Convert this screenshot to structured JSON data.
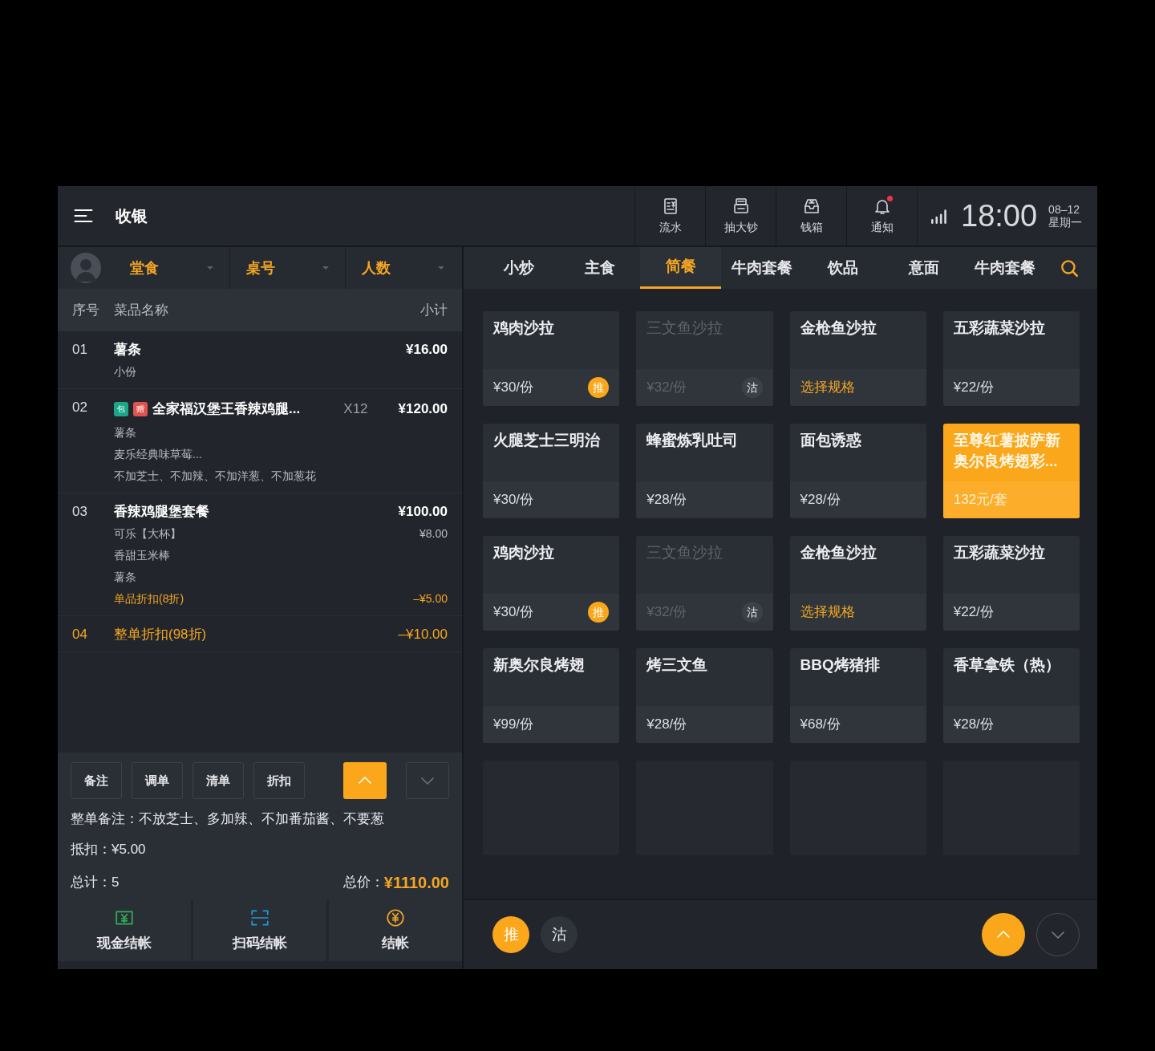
{
  "header": {
    "title": "收银"
  },
  "tools": [
    {
      "label": "流水",
      "kind": "ledger",
      "alert": false
    },
    {
      "label": "抽大钞",
      "kind": "printer",
      "alert": false
    },
    {
      "label": "钱箱",
      "kind": "drawer",
      "alert": false
    },
    {
      "label": "通知",
      "kind": "bell",
      "alert": true
    }
  ],
  "status": {
    "time": "18:00",
    "date": "08–12",
    "weekday": "星期一"
  },
  "filters": [
    {
      "label": "堂食"
    },
    {
      "label": "桌号"
    },
    {
      "label": "人数"
    }
  ],
  "tabs": [
    {
      "label": "小炒",
      "selected": false
    },
    {
      "label": "主食",
      "selected": false
    },
    {
      "label": "简餐",
      "selected": true
    },
    {
      "label": "牛肉套餐",
      "selected": false
    },
    {
      "label": "饮品",
      "selected": false
    },
    {
      "label": "意面",
      "selected": false
    },
    {
      "label": "牛肉套餐",
      "selected": false
    }
  ],
  "order": {
    "columns": [
      "序号",
      "菜品名称",
      "小计"
    ],
    "rows": [
      {
        "kind": "item",
        "index": "01",
        "name": "薯条",
        "price": "¥16.00",
        "details": [
          {
            "kind": "option",
            "text": "小份"
          }
        ]
      },
      {
        "kind": "item",
        "index": "02",
        "tags": [
          {
            "label": "包",
            "color": "#1aa88a"
          },
          {
            "label": "赠",
            "color": "#e0524f"
          }
        ],
        "name": "全家福汉堡王香辣鸡腿...",
        "qty": "X12",
        "price": "¥120.00",
        "details": [
          {
            "kind": "option",
            "text": "薯条"
          },
          {
            "kind": "option",
            "text": "麦乐经典味草莓..."
          },
          {
            "kind": "option",
            "text": "不加芝士、不加辣、不加洋葱、不加葱花"
          }
        ]
      },
      {
        "kind": "item",
        "index": "03",
        "name": "香辣鸡腿堡套餐",
        "price": "¥100.00",
        "details": [
          {
            "kind": "option",
            "text": "可乐【大杯】",
            "price": "¥8.00"
          },
          {
            "kind": "option",
            "text": "香甜玉米棒"
          },
          {
            "kind": "option",
            "text": "薯条"
          },
          {
            "kind": "discount",
            "text": "单品折扣(8折)",
            "price": "–¥5.00"
          }
        ]
      },
      {
        "kind": "discount",
        "index": "04",
        "name": "整单折扣(98折)",
        "price": "–¥10.00"
      }
    ]
  },
  "actions": [
    "备注",
    "调单",
    "清单",
    "折扣"
  ],
  "order_scroll": [
    {
      "kind": "up",
      "selected": true
    },
    {
      "kind": "down",
      "selected": false
    }
  ],
  "note": "整单备注：不放芝士、多加辣、不加番茄酱、不要葱",
  "deduction": "抵扣：¥5.00",
  "count": "总计：5",
  "total_label": "总价：",
  "total": "¥1110.00",
  "payments": [
    {
      "kind": "cash",
      "label": "现金结帐"
    },
    {
      "kind": "scan",
      "label": "扫码结帐"
    },
    {
      "kind": "coin",
      "label": "结帐"
    }
  ],
  "dishes": [
    {
      "kind": "normal",
      "name": "鸡肉沙拉",
      "price": "¥30/份",
      "badge": "推"
    },
    {
      "kind": "sold_out",
      "name": "三文鱼沙拉",
      "price": "¥32/份",
      "badge": "沽"
    },
    {
      "kind": "spec",
      "name": "金枪鱼沙拉",
      "price": "选择规格"
    },
    {
      "kind": "normal",
      "name": "五彩蔬菜沙拉",
      "price": "¥22/份"
    },
    {
      "kind": "normal",
      "name": "火腿芝士三明治",
      "price": "¥30/份"
    },
    {
      "kind": "normal",
      "name": "蜂蜜炼乳吐司",
      "price": "¥28/份"
    },
    {
      "kind": "normal",
      "name": "面包诱惑",
      "price": "¥28/份"
    },
    {
      "kind": "selected",
      "name": "至尊红薯披萨新奥尔良烤翅彩...",
      "price": "132元/套"
    },
    {
      "kind": "normal",
      "name": "鸡肉沙拉",
      "price": "¥30/份",
      "badge": "推"
    },
    {
      "kind": "sold_out",
      "name": "三文鱼沙拉",
      "price": "¥32/份",
      "badge": "沽"
    },
    {
      "kind": "spec",
      "name": "金枪鱼沙拉",
      "price": "选择规格"
    },
    {
      "kind": "normal",
      "name": "五彩蔬菜沙拉",
      "price": "¥22/份"
    },
    {
      "kind": "normal",
      "name": "新奥尔良烤翅",
      "price": "¥99/份"
    },
    {
      "kind": "normal",
      "name": "烤三文鱼",
      "price": "¥28/份"
    },
    {
      "kind": "normal",
      "name": "BBQ烤猪排",
      "price": "¥68/份"
    },
    {
      "kind": "normal",
      "name": "香草拿铁（热）",
      "price": "¥28/份"
    },
    {
      "kind": "empty"
    },
    {
      "kind": "empty"
    },
    {
      "kind": "empty"
    },
    {
      "kind": "empty"
    }
  ],
  "legend": [
    {
      "label": "推",
      "selected": true
    },
    {
      "label": "沽",
      "selected": false
    }
  ],
  "page_scroll": [
    {
      "kind": "up",
      "selected": true
    },
    {
      "kind": "down",
      "selected": false
    }
  ]
}
